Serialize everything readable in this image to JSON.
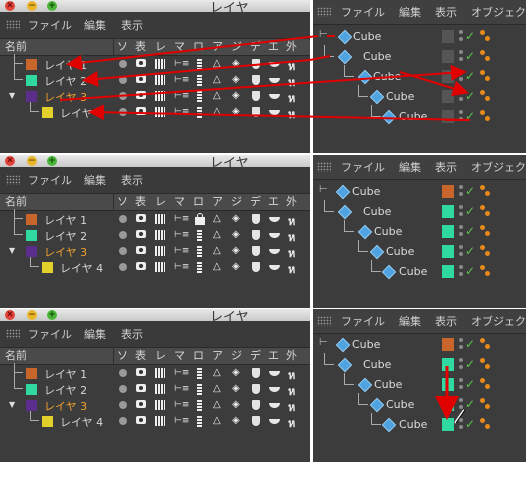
{
  "layer_manager": {
    "title": "レイヤ",
    "menu": [
      "ファイル",
      "編集",
      "表示"
    ],
    "column_name": "名前",
    "columns": [
      "ソ",
      "表",
      "レ",
      "マ",
      "ロ",
      "ア",
      "ジ",
      "デ",
      "エ",
      "外"
    ],
    "layers": [
      {
        "name": "レイヤ 1",
        "color": "#c8652a",
        "active": false
      },
      {
        "name": "レイヤ 2",
        "color": "#2fd9a0",
        "active": false
      },
      {
        "name": "レイヤ 3",
        "color": "#5b2d8c",
        "active": true
      },
      {
        "name": "レイヤ 4",
        "color": "#e1d12a",
        "active": false
      }
    ]
  },
  "object_manager": {
    "menu": [
      "ファイル",
      "編集",
      "表示",
      "オブジェク"
    ],
    "objects": [
      "Cube",
      "Cube",
      "Cube",
      "Cube",
      "Cube"
    ]
  },
  "panels": [
    {
      "object_layer_colors": [
        "",
        "",
        "",
        "",
        ""
      ]
    },
    {
      "object_layer_colors": [
        "#c8652a",
        "#2fd9a0",
        "#2fd9a0",
        "#2fd9a0",
        "#2fd9a0"
      ]
    },
    {
      "object_layer_colors": [
        "#c8652a",
        "#2fd9a0",
        "#2fd9a0",
        "#2fd9a0",
        "#2fd9a0"
      ]
    }
  ],
  "colors": {
    "active_layer": "#f0a030",
    "arrow": "#e00000",
    "check": "#5cc24e"
  }
}
